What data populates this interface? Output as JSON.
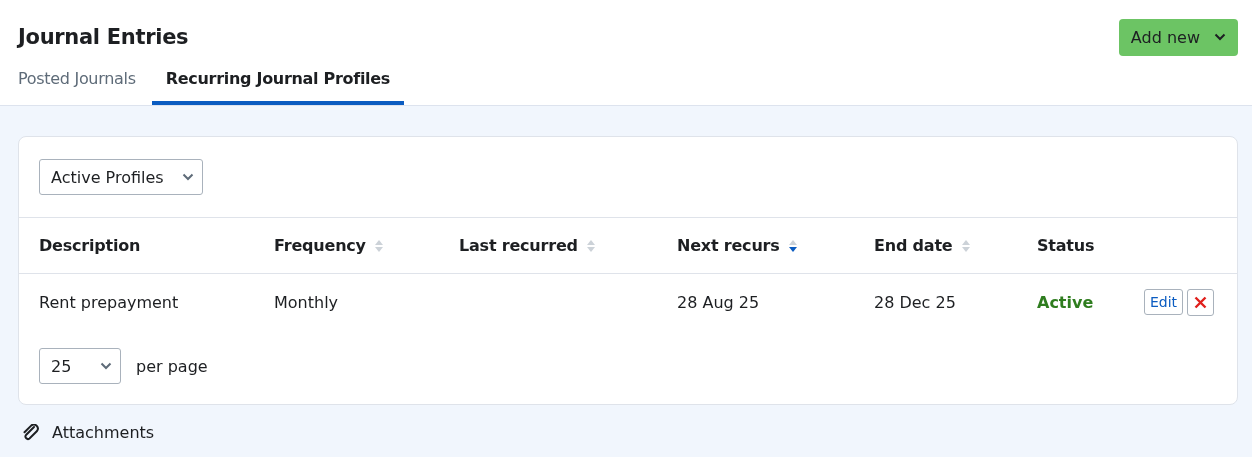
{
  "header": {
    "title": "Journal Entries",
    "add_button": "Add new"
  },
  "tabs": [
    {
      "label": "Posted Journals",
      "selected": false
    },
    {
      "label": "Recurring Journal Profiles",
      "selected": true
    }
  ],
  "filter": {
    "value": "Active Profiles"
  },
  "table": {
    "columns": [
      {
        "label": "Description"
      },
      {
        "label": "Frequency",
        "sortable": true,
        "sorted_descending": false
      },
      {
        "label": "Last recurred",
        "sortable": true,
        "sorted_descending": false
      },
      {
        "label": "Next recurs",
        "sortable": true,
        "sorted_descending": true
      },
      {
        "label": "End date",
        "sortable": true,
        "sorted_descending": false
      },
      {
        "label": "Status"
      }
    ],
    "rows": [
      {
        "cells": [
          "Rent prepayment",
          "Monthly",
          "",
          "28 Aug 25",
          "28 Dec 25"
        ],
        "status": {
          "text": "Active",
          "kind": "active"
        },
        "edit": "Edit"
      }
    ]
  },
  "pagination": {
    "page_size": "25",
    "label": "per page"
  },
  "attachments": "Attachments"
}
